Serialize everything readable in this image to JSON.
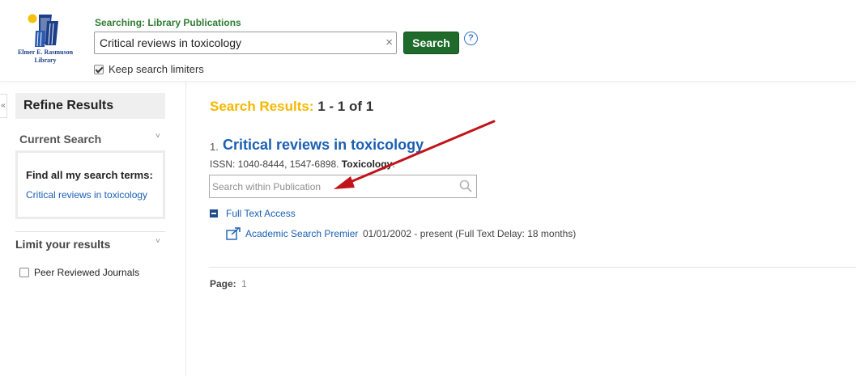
{
  "header": {
    "logo_line1": "Elmer E. Rasmuson",
    "logo_line2": "Library",
    "searching_label": "Searching: Library Publications",
    "search_value": "Critical reviews in toxicology",
    "clear_glyph": "×",
    "search_button": "Search",
    "help_glyph": "?",
    "keep_limiters_label": "Keep search limiters",
    "keep_limiters_checked": true
  },
  "sidebar": {
    "collapse_glyph": "«",
    "refine_title": "Refine Results",
    "current_search_title": "Current Search",
    "find_terms_label": "Find all my search terms:",
    "current_term": "Critical reviews in toxicology",
    "limit_title": "Limit your results",
    "peer_reviewed_label": "Peer Reviewed Journals",
    "peer_reviewed_checked": false,
    "chevron_glyph": "˅"
  },
  "results": {
    "heading_label": "Search Results:",
    "heading_range": "1 - 1 of 1",
    "items": [
      {
        "number": "1.",
        "title": "Critical reviews in toxicology",
        "issn_prefix": "ISSN: 1040-8444, 1547-6898.",
        "subject": "Toxicology",
        "issn_suffix": ".",
        "search_within_placeholder": "Search within Publication",
        "full_text_access_label": "Full Text Access",
        "provider_link": "Academic Search Premier",
        "provider_dates": "01/01/2002 - present (Full Text Delay: 18 months)"
      }
    ],
    "page_label": "Page:",
    "page_number": "1"
  },
  "colors": {
    "accent_green": "#1f6b2b",
    "heading_yellow": "#f5b800",
    "link_blue": "#1a5fb4",
    "annotation_arrow": "#c0141a"
  }
}
